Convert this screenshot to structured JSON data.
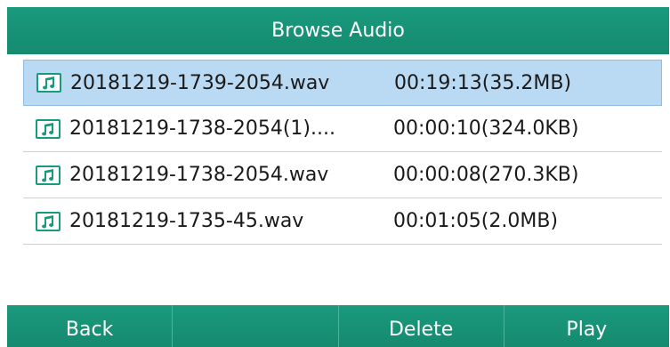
{
  "title": "Browse Audio",
  "files": [
    {
      "name": "20181219-1739-2054.wav",
      "info": "00:19:13(35.2MB)",
      "selected": true
    },
    {
      "name": "20181219-1738-2054(1)....",
      "info": "00:00:10(324.0KB)",
      "selected": false
    },
    {
      "name": "20181219-1738-2054.wav",
      "info": "00:00:08(270.3KB)",
      "selected": false
    },
    {
      "name": "20181219-1735-45.wav",
      "info": "00:01:05(2.0MB)",
      "selected": false
    }
  ],
  "softkeys": [
    "Back",
    "",
    "Delete",
    "Play"
  ],
  "colors": {
    "accent": "#179b7e",
    "selection": "#bad9f2"
  },
  "icons": {
    "file": "music-note-icon"
  }
}
